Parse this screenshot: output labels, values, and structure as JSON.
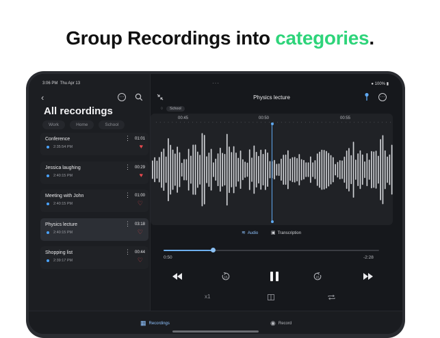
{
  "headline": {
    "pre": "Group Recordings into ",
    "accent": "categories",
    "post": "."
  },
  "colors": {
    "accent": "#2ed47a",
    "highlight": "#5fa9f2",
    "heart": "#e5484d"
  },
  "status": {
    "time": "3:06 PM",
    "date": "Thu Apr 13",
    "battery": "100%"
  },
  "sidebar": {
    "title": "All recordings",
    "filters": [
      "Work",
      "Home",
      "School"
    ],
    "recordings": [
      {
        "name": "Conference",
        "time": "2:35:54 PM",
        "duration": "01:01",
        "favorite": true
      },
      {
        "name": "Jessica laughing",
        "time": "2:40:15 PM",
        "duration": "00:29",
        "favorite": true
      },
      {
        "name": "Meeting with John",
        "time": "2:40:15 PM",
        "duration": "01:00",
        "favorite": false
      },
      {
        "name": "Physics lecture",
        "time": "2:40:15 PM",
        "duration": "03:18",
        "favorite": false,
        "selected": true
      },
      {
        "name": "Shopping list",
        "time": "2:39:17 PM",
        "duration": "00:44",
        "favorite": false
      }
    ]
  },
  "detail": {
    "title": "Physics lecture",
    "tag": "School",
    "timeline_labels": [
      "00:45",
      "00:50",
      "00:55"
    ],
    "view_tabs": {
      "audio": "Audio",
      "transcription": "Transcription"
    },
    "progress": 0.23,
    "elapsed": "0:50",
    "remaining": "-2:28",
    "speed": "x1"
  },
  "icons": [
    "back-icon",
    "more-icon",
    "search-icon",
    "collapse-icon",
    "pin-icon",
    "rewind-icon",
    "skip-back-icon",
    "pause-icon",
    "skip-forward-icon",
    "fast-forward-icon",
    "book-icon",
    "repeat-icon",
    "grid-icon",
    "record-icon"
  ],
  "tabs": {
    "recordings": "Recordings",
    "record": "Record"
  }
}
